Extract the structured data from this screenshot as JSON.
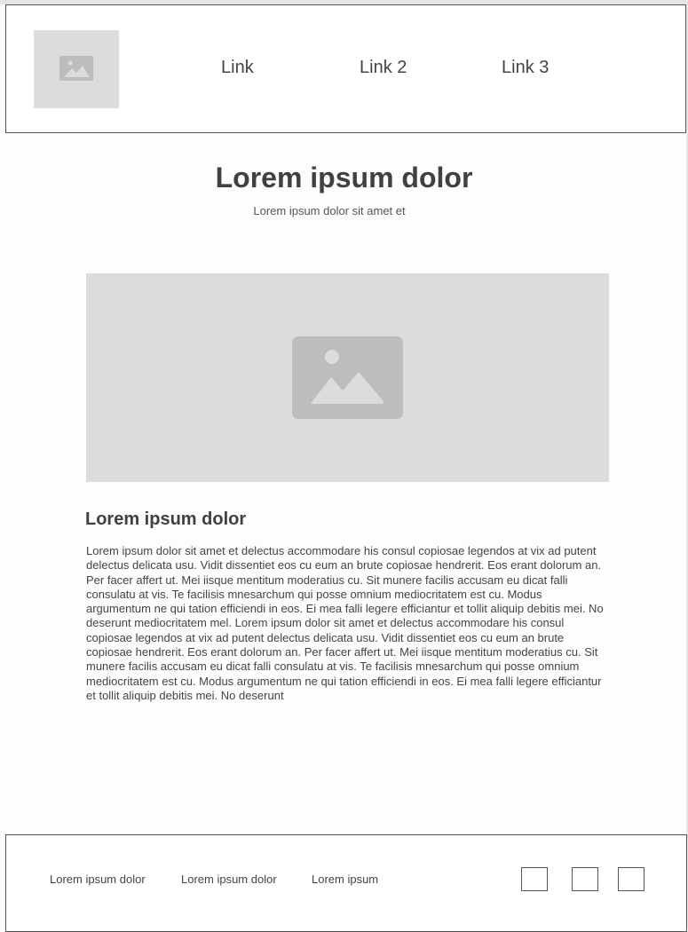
{
  "header": {
    "logo_icon": "image-placeholder-icon",
    "nav": [
      "Link",
      "Link 2",
      "Link 3"
    ]
  },
  "main": {
    "title": "Lorem ipsum dolor",
    "subtitle": "Lorem ipsum dolor sit amet et",
    "hero_icon": "image-placeholder-icon",
    "section_title": "Lorem ipsum dolor",
    "body": "Lorem ipsum dolor sit amet et delectus accommodare his consul copiosae legendos at vix ad putent delectus delicata usu. Vidit dissentiet eos cu eum an brute copiosae hendrerit. Eos erant dolorum an. Per facer affert ut. Mei iisque mentitum moderatius cu. Sit munere facilis accusam eu dicat falli consulatu at vis. Te facilisis mnesarchum qui posse omnium mediocritatem est cu. Modus argumentum ne qui tation efficiendi in eos. Ei mea falli legere efficiantur et tollit aliquip debitis mei. No deserunt mediocritatem mel. Lorem ipsum dolor sit amet et delectus accommodare his consul copiosae legendos at vix ad putent delectus delicata usu. Vidit dissentiet eos cu eum an brute copiosae hendrerit. Eos erant dolorum an. Per facer affert ut. Mei iisque mentitum moderatius cu. Sit munere facilis accusam eu dicat falli consulatu at vis. Te facilisis mnesarchum qui posse omnium mediocritatem est cu. Modus argumentum ne qui tation efficiendi in eos. Ei mea falli legere efficiantur et tollit aliquip debitis mei. No deserunt"
  },
  "footer": {
    "links": [
      "Lorem ipsum dolor",
      "Lorem ipsum dolor",
      "Lorem ipsum"
    ],
    "social_icons": [
      "social-icon-1",
      "social-icon-2",
      "social-icon-3"
    ]
  },
  "colors": {
    "placeholder": "#dcdcdc",
    "placeholder_icon": "#bdbdbd",
    "text": "#404040",
    "border": "#555555"
  }
}
